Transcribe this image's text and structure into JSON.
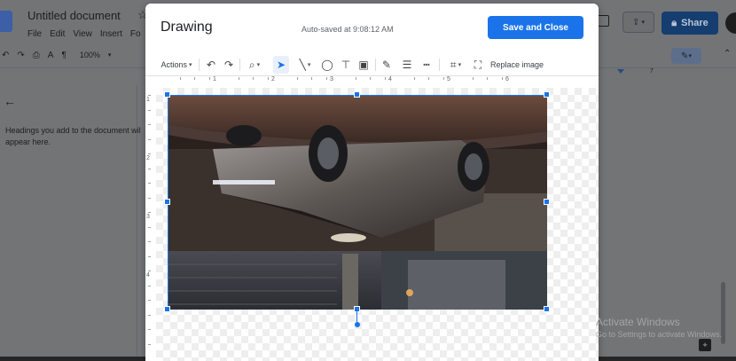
{
  "docs": {
    "document_title": "Untitled document",
    "star_icon": "star-icon",
    "menu": [
      "File",
      "Edit",
      "View",
      "Insert",
      "Fo"
    ],
    "zoom": "100%",
    "outline_text_line1": "Headings you add to the document wil",
    "outline_text_line2": "appear here.",
    "share_label": "Share",
    "ruler_right_mark": "7"
  },
  "drawing_dialog": {
    "title": "Drawing",
    "autosave_status": "Auto-saved at 9:08:12 AM",
    "save_close_label": "Save and Close",
    "toolbar": {
      "actions_label": "Actions",
      "replace_image_label": "Replace image"
    },
    "h_ruler_numbers": [
      "1",
      "2",
      "3",
      "4",
      "5",
      "6"
    ],
    "v_ruler_numbers": [
      "1",
      "2",
      "3",
      "4"
    ]
  },
  "system": {
    "activate_title": "Activate Windows",
    "activate_subtitle": "Go to Settings to activate Windows."
  },
  "colors": {
    "accent_blue": "#1a73e8",
    "dim_overlay": "#737476",
    "share_button": "#153d70"
  }
}
